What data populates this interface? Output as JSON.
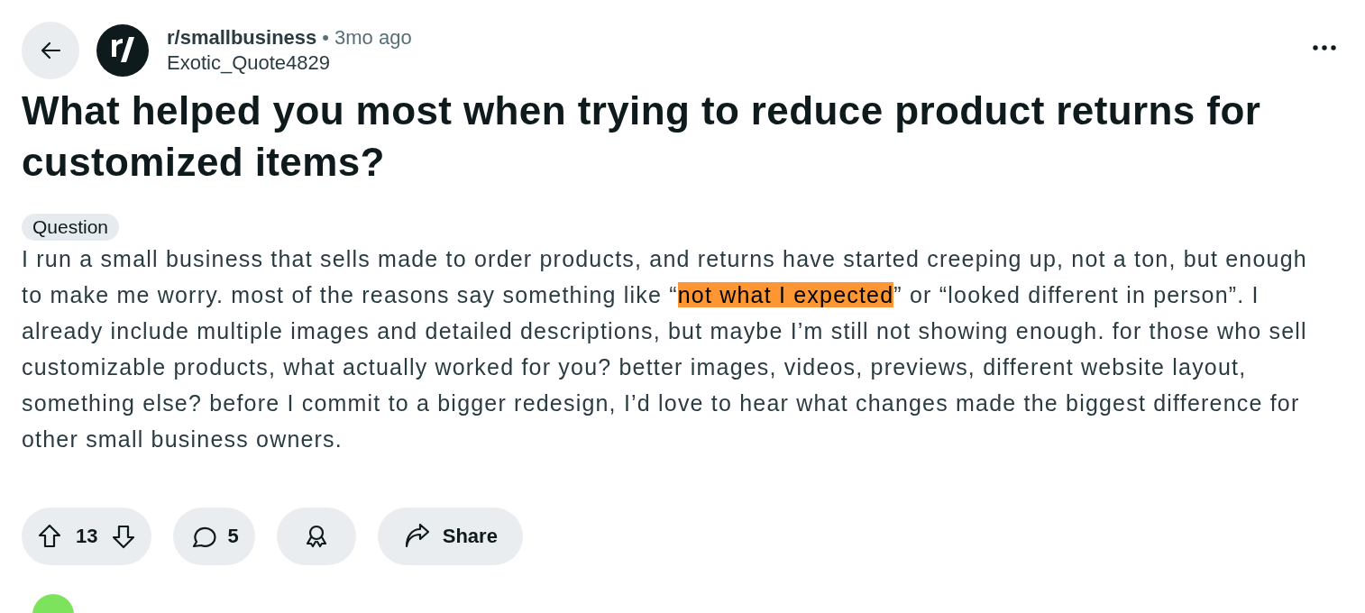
{
  "header": {
    "community": "r/smallbusiness",
    "separator": "•",
    "time": "3mo ago",
    "author": "Exotic_Quote4829"
  },
  "post": {
    "title": "What helped you most when trying to reduce product returns for customized items?",
    "flair": "Question",
    "body": [
      {
        "text": "I run a small business that sells made to order products, and returns have started creeping up, not a ton, but enough to make me worry. most of the reasons say something like “",
        "highlighted": false
      },
      {
        "text": "not what I expected",
        "highlighted": true
      },
      {
        "text": "” or “looked different in person”. I already include multiple images and detailed descriptions, but maybe I’m still not showing enough. for those who sell customizable products, what actually worked for you? better images, videos, previews, different website layout, something else? before I commit to a bigger redesign, I’d love to hear what changes made the biggest difference for other small business owners.",
        "highlighted": false
      }
    ]
  },
  "actions": {
    "score": "13",
    "comments": "5",
    "share": "Share"
  }
}
